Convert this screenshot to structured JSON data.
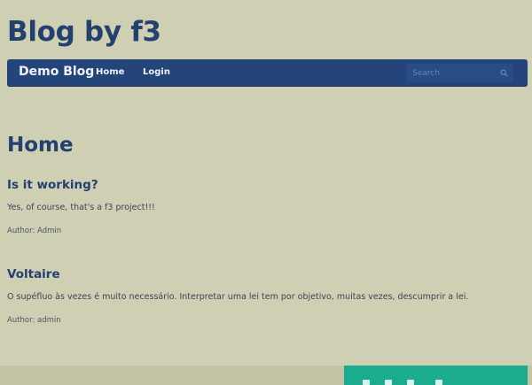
{
  "site": {
    "title": "Blog by f3"
  },
  "navbar": {
    "brand": "Demo Blog",
    "links": [
      {
        "label": "Home"
      },
      {
        "label": "Login"
      }
    ],
    "search": {
      "placeholder": "Search",
      "value": "",
      "icon": "search-icon"
    }
  },
  "page": {
    "heading": "Home"
  },
  "posts": [
    {
      "title": "Is it working?",
      "body": "Yes, of course, that's a f3 project!!!",
      "author": "Author: Admin"
    },
    {
      "title": "Voltaire",
      "body": "O supéfluo às vezes é muito necessário. Interpretar uma lei tem por objetivo, muitas vezes, descumprir a lei.",
      "author": "Author: admin"
    }
  ],
  "footer": {
    "button_color": "#1bab8f"
  }
}
